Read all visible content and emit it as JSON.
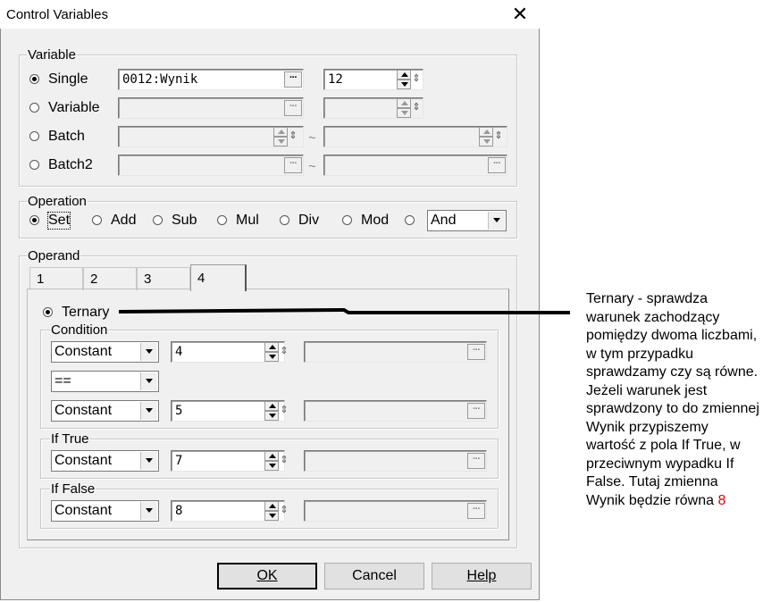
{
  "window": {
    "title": "Control Variables",
    "close_glyph": "✕"
  },
  "variable": {
    "legend": "Variable",
    "rows": [
      {
        "label": "Single",
        "selected": true,
        "value": "0012:Wynik",
        "number": "12"
      },
      {
        "label": "Variable",
        "selected": false,
        "value": "",
        "number": ""
      },
      {
        "label": "Batch",
        "selected": false,
        "value": "",
        "number": ""
      },
      {
        "label": "Batch2",
        "selected": false,
        "value": "",
        "number": ""
      }
    ],
    "tilde": "~"
  },
  "operation": {
    "legend": "Operation",
    "options": [
      "Set",
      "Add",
      "Sub",
      "Mul",
      "Div",
      "Mod"
    ],
    "selected": "Set",
    "combo_value": "And"
  },
  "operand": {
    "legend": "Operand",
    "tabs": [
      "1",
      "2",
      "3",
      "4"
    ],
    "active_tab": "4",
    "ternary_label": "Ternary",
    "condition": {
      "legend": "Condition",
      "left": {
        "type": "Constant",
        "value": "4"
      },
      "comparator": "==",
      "right": {
        "type": "Constant",
        "value": "5"
      }
    },
    "if_true": {
      "legend": "If True",
      "type": "Constant",
      "value": "7"
    },
    "if_false": {
      "legend": "If False",
      "type": "Constant",
      "value": "8"
    }
  },
  "buttons": {
    "ok": "OK",
    "cancel": "Cancel",
    "help": "Help"
  },
  "annotation": {
    "text": "Ternary - sprawdza warunek zachodzący pomiędzy dwoma liczbami, w tym przypadku sprawdzamy czy są równe. Jeżeli warunek jest sprawdzony to do zmiennej Wynik przypiszemy wartość z pola If True, w przeciwnym wypadku If False. Tutaj zmienna Wynik będzie równa",
    "highlight": "8",
    "highlight_color": "#e00000"
  }
}
